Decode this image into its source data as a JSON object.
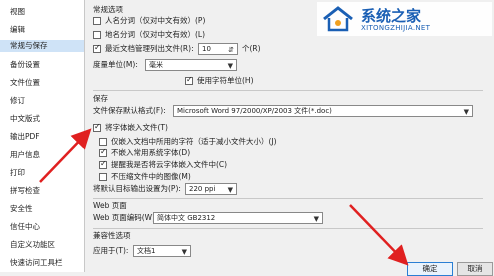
{
  "sidebar": {
    "items": [
      {
        "label": "视图"
      },
      {
        "label": "编辑"
      },
      {
        "label": "常规与保存",
        "active": true
      },
      {
        "label": "备份设置"
      },
      {
        "label": "文件位置"
      },
      {
        "label": "修订"
      },
      {
        "label": "中文版式"
      },
      {
        "label": "输出PDF"
      },
      {
        "label": "用户信息"
      },
      {
        "label": "打印"
      },
      {
        "label": "拼写检查"
      },
      {
        "label": "安全性"
      },
      {
        "label": "信任中心"
      },
      {
        "label": "自定义功能区"
      },
      {
        "label": "快速访问工具栏"
      }
    ]
  },
  "general": {
    "title": "常规选项",
    "pinyin_name": "人名分词（仅对中文有效）(P)",
    "place_name": "地名分词（仅对中文有效）(L)",
    "recent_files": "最近文档管理列出文件(R):",
    "recent_count": "10",
    "recent_unit": "个(R)",
    "unit_label": "度量单位(M):",
    "unit_value": "毫米",
    "char_unit": "使用字符单位(H)"
  },
  "save": {
    "title": "保存",
    "format_label": "文件保存默认格式(F):",
    "format_value": "Microsoft Word 97/2000/XP/2003 文件(*.doc)",
    "embed_fonts": "将字体嵌入文件(T)",
    "embed_used_only": "仅嵌入文档中所用的字符（适于减小文件大小）(J)",
    "no_common_fonts": "不嵌入常用系统字体(D)",
    "cloud_fonts": "提醒我是否将云字体嵌入文件中(C)",
    "no_compress": "不压缩文件中的图像(M)",
    "target_label": "将默认目标输出设置为(P):",
    "target_value": "220 ppi"
  },
  "web": {
    "title": "Web 页面",
    "encoding_label": "Web 页面编码(W):",
    "encoding_value": "简体中文 GB2312"
  },
  "compat": {
    "title": "兼容性选项",
    "apply_label": "应用于(T):",
    "apply_value": "文档1"
  },
  "buttons": {
    "ok": "确定",
    "cancel": "取消"
  },
  "watermark": {
    "title": "系统之家",
    "url": "XITONGZHIJIA.NET"
  },
  "colors": {
    "accent": "#1a5fb4",
    "arrow": "#e02020",
    "selection": "#cfe3f7"
  }
}
